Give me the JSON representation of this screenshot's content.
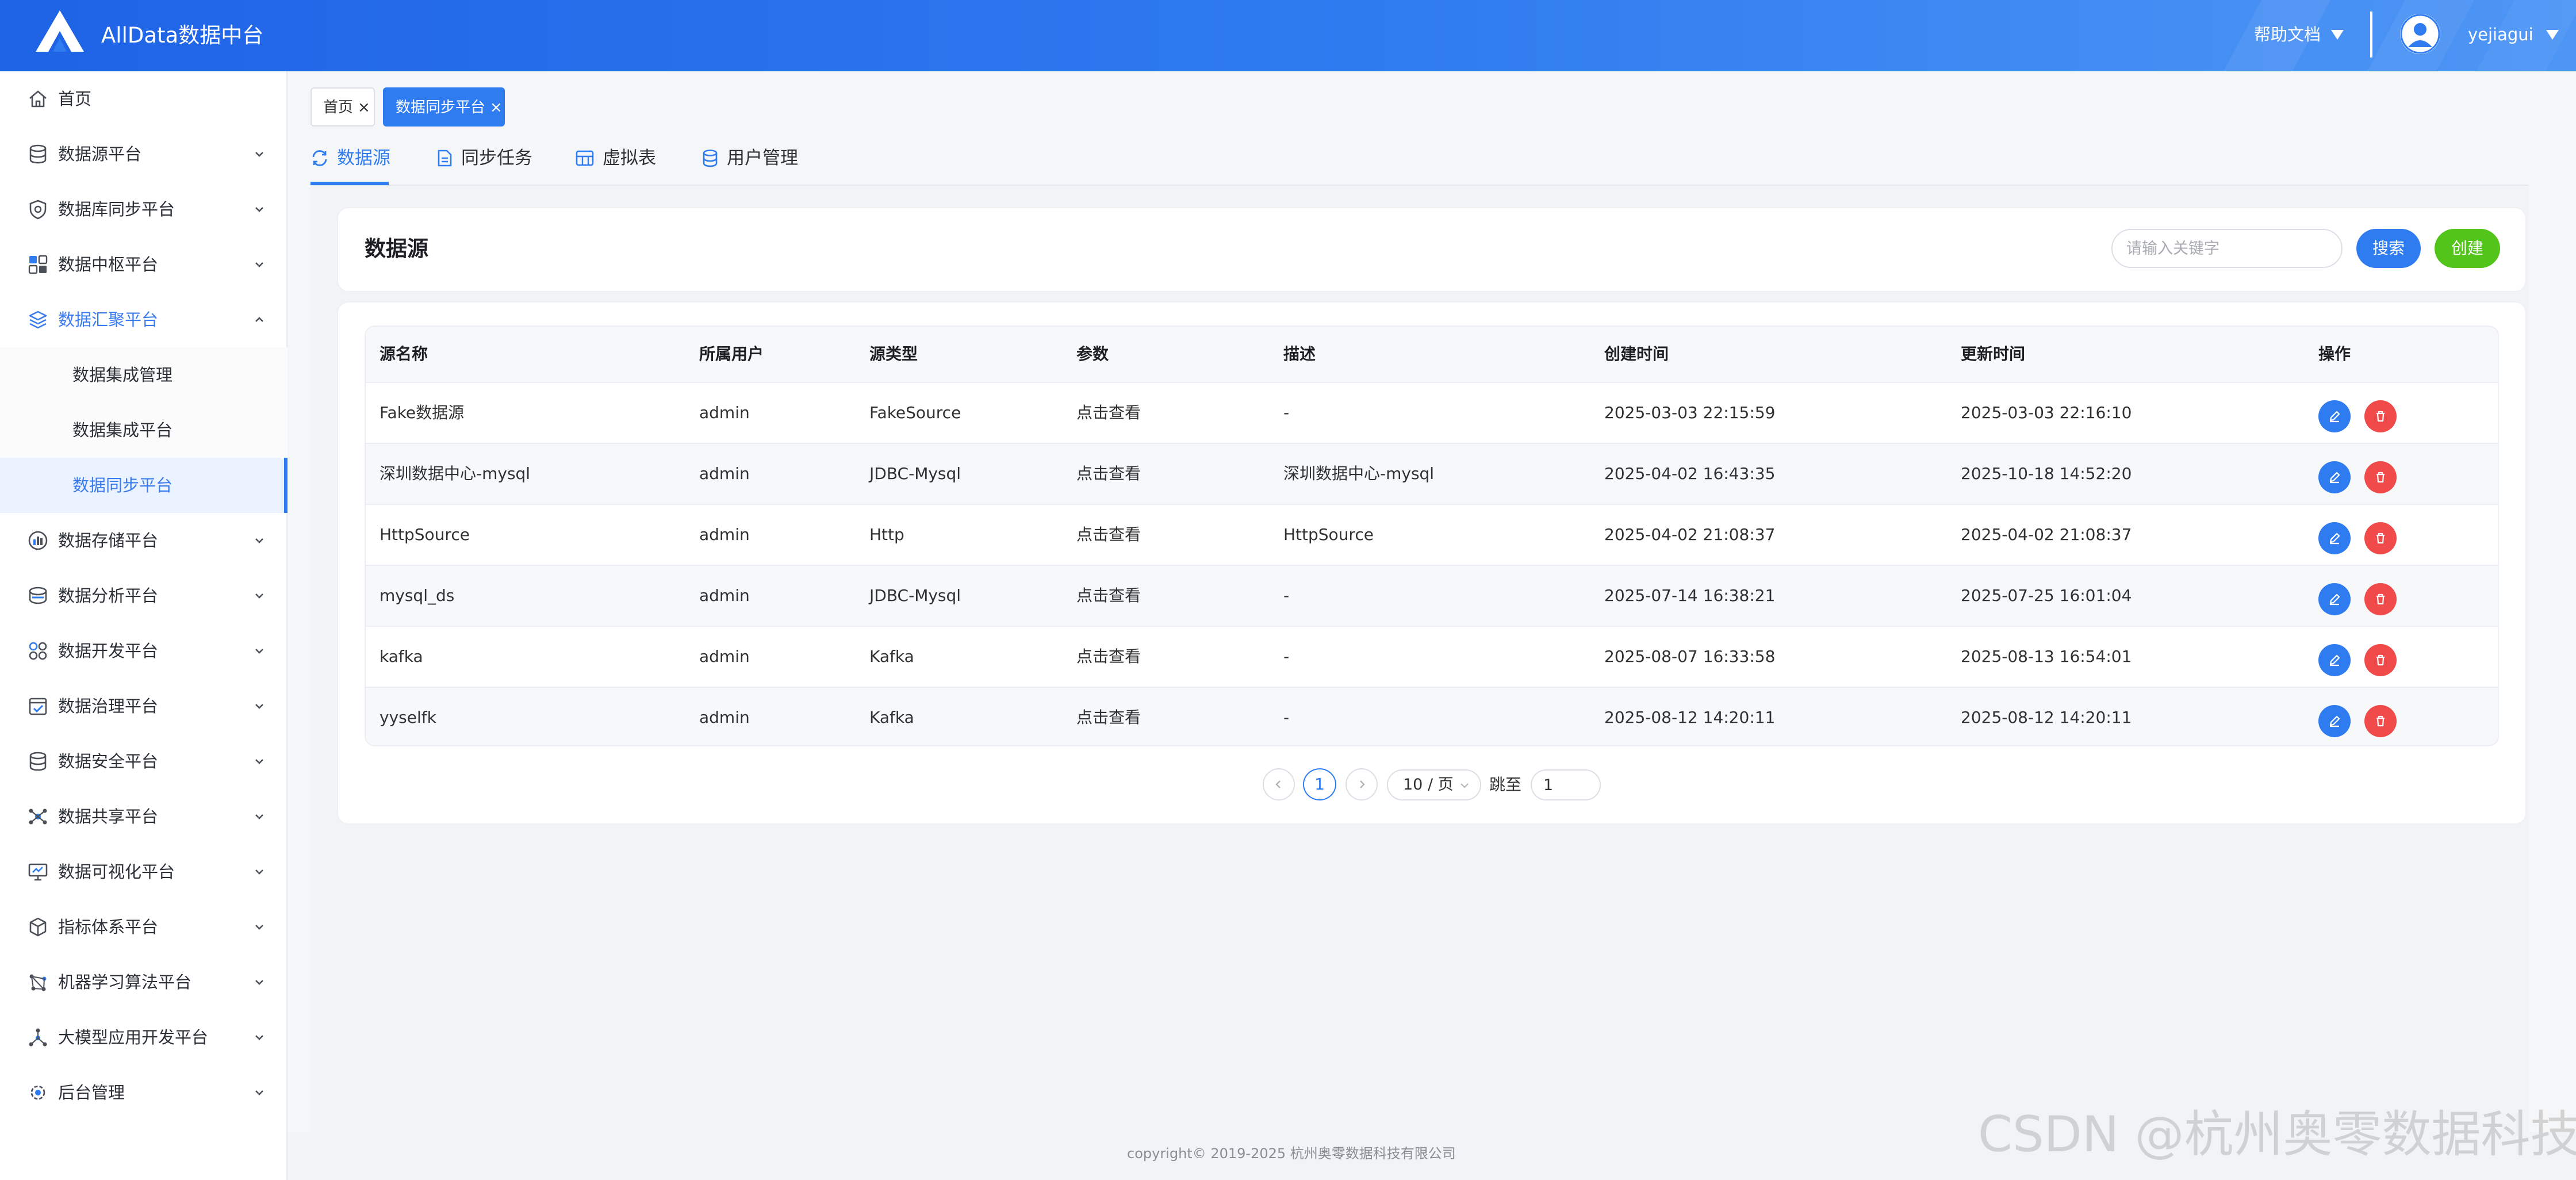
{
  "header": {
    "app_title": "AllData数据中台",
    "help_label": "帮助文档",
    "username": "yejiagui",
    "colors": {
      "bar": "#2f7cf0",
      "text": "#ffffff"
    }
  },
  "sidebar": {
    "items": [
      {
        "label": "首页",
        "icon": "home-icon"
      },
      {
        "label": "数据源平台",
        "icon": "database-icon"
      },
      {
        "label": "数据库同步平台",
        "icon": "shield-sync-icon"
      },
      {
        "label": "数据中枢平台",
        "icon": "hub-icon"
      },
      {
        "label": "数据汇聚平台",
        "icon": "layers-icon",
        "expanded": true
      },
      {
        "label": "数据存储平台",
        "icon": "storage-chart-icon"
      },
      {
        "label": "数据分析平台",
        "icon": "analysis-icon"
      },
      {
        "label": "数据开发平台",
        "icon": "apps-icon"
      },
      {
        "label": "数据治理平台",
        "icon": "governance-icon"
      },
      {
        "label": "数据安全平台",
        "icon": "security-db-icon"
      },
      {
        "label": "数据共享平台",
        "icon": "share-icon"
      },
      {
        "label": "数据可视化平台",
        "icon": "monitor-icon"
      },
      {
        "label": "指标体系平台",
        "icon": "cube-icon"
      },
      {
        "label": "机器学习算法平台",
        "icon": "ml-icon"
      },
      {
        "label": "大模型应用开发平台",
        "icon": "llm-icon"
      },
      {
        "label": "后台管理",
        "icon": "admin-icon"
      }
    ],
    "subitems": [
      {
        "label": "数据集成管理"
      },
      {
        "label": "数据集成平台"
      },
      {
        "label": "数据同步平台",
        "active": true
      }
    ],
    "accent_color": "#2f7cf0"
  },
  "tags": [
    {
      "label": "首页"
    },
    {
      "label": "数据同步平台",
      "active": true
    }
  ],
  "tabs": [
    {
      "label": "数据源",
      "active": true
    },
    {
      "label": "同步任务"
    },
    {
      "label": "虚拟表"
    },
    {
      "label": "用户管理"
    }
  ],
  "panel": {
    "title": "数据源",
    "search_placeholder": "请输入关键字",
    "search_button": "搜索",
    "create_button": "创建"
  },
  "table": {
    "columns": [
      "源名称",
      "所属用户",
      "源类型",
      "参数",
      "描述",
      "创建时间",
      "更新时间",
      "操作"
    ],
    "rows": [
      {
        "name": "Fake数据源",
        "user": "admin",
        "type": "FakeSource",
        "params": "点击查看",
        "desc": "-",
        "created": "2025-03-03 22:15:59",
        "updated": "2025-03-03 22:16:10"
      },
      {
        "name": "深圳数据中心-mysql",
        "user": "admin",
        "type": "JDBC-Mysql",
        "params": "点击查看",
        "desc": "深圳数据中心-mysql",
        "created": "2025-04-02 16:43:35",
        "updated": "2025-10-18 14:52:20"
      },
      {
        "name": "HttpSource",
        "user": "admin",
        "type": "Http",
        "params": "点击查看",
        "desc": "HttpSource",
        "created": "2025-04-02 21:08:37",
        "updated": "2025-04-02 21:08:37"
      },
      {
        "name": "mysql_ds",
        "user": "admin",
        "type": "JDBC-Mysql",
        "params": "点击查看",
        "desc": "-",
        "created": "2025-07-14 16:38:21",
        "updated": "2025-07-25 16:01:04"
      },
      {
        "name": "kafka",
        "user": "admin",
        "type": "Kafka",
        "params": "点击查看",
        "desc": "-",
        "created": "2025-08-07 16:33:58",
        "updated": "2025-08-13 16:54:01"
      },
      {
        "name": "yyselfk",
        "user": "admin",
        "type": "Kafka",
        "params": "点击查看",
        "desc": "-",
        "created": "2025-08-12 14:20:11",
        "updated": "2025-08-12 14:20:11"
      }
    ],
    "edit_color": "#2f7cf0",
    "delete_color": "#f04a4a"
  },
  "pagination": {
    "current_page": "1",
    "page_size": "10 / 页",
    "jump_label": "跳至",
    "jump_value": "1"
  },
  "footer": {
    "copyright": "copyright© 2019-2025 杭州奥零数据科技有限公司",
    "watermark": "CSDN @杭州奥零数据科技"
  }
}
